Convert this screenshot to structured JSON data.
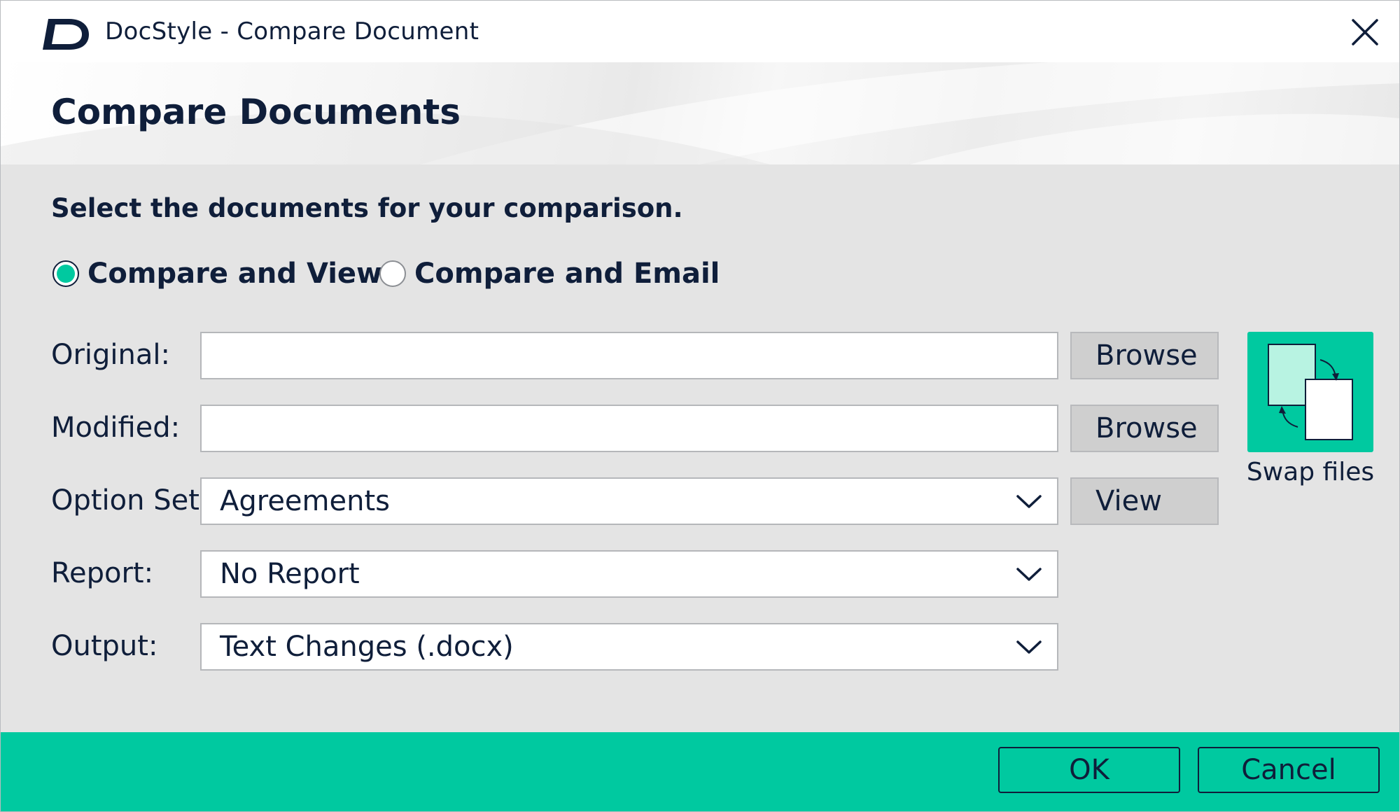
{
  "window": {
    "title": "DocStyle - Compare Document",
    "logo_icon": "docstyle-logo-icon",
    "close_icon": "close-icon"
  },
  "header": {
    "title": "Compare Documents"
  },
  "main": {
    "instruction": "Select the documents for your comparison.",
    "mode_options": [
      {
        "label": "Compare and View",
        "selected": true
      },
      {
        "label": "Compare and Email",
        "selected": false
      }
    ],
    "original": {
      "label": "Original:",
      "value": "",
      "browse_label": "Browse"
    },
    "modified": {
      "label": "Modified:",
      "value": "",
      "browse_label": "Browse"
    },
    "option_set": {
      "label": "Option Set",
      "value": "Agreements",
      "view_label": "View"
    },
    "report": {
      "label": "Report:",
      "value": "No Report"
    },
    "output": {
      "label": "Output:",
      "value": "Text Changes (.docx)"
    },
    "swap": {
      "label": "Swap files",
      "icon": "swap-files-icon"
    }
  },
  "footer": {
    "ok_label": "OK",
    "cancel_label": "Cancel"
  },
  "colors": {
    "accent": "#00c9a0",
    "text": "#0f1e3a",
    "body_bg": "#e4e4e4",
    "button_bg": "#cfcfcf"
  }
}
